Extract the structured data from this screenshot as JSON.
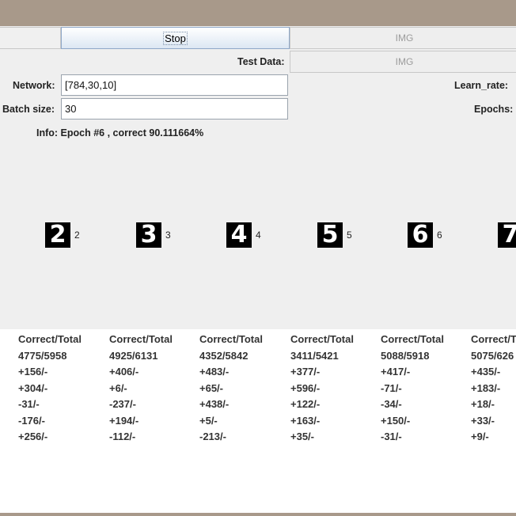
{
  "toolbar": {
    "stop_label": "Stop",
    "img_label_1": "IMG",
    "img_label_2": "IMG",
    "test_data_label": "Test Data:"
  },
  "config": {
    "network_label": "Network:",
    "network_value": "[784,30,10]",
    "batch_label": "Batch size:",
    "batch_value": "30",
    "learn_rate_label": "Learn_rate:",
    "epochs_label": "Epochs:"
  },
  "info": "Info: Epoch #6 , correct 90.111664%",
  "digits": [
    {
      "glyph": "2",
      "label": "2"
    },
    {
      "glyph": "3",
      "label": "3"
    },
    {
      "glyph": "4",
      "label": "4"
    },
    {
      "glyph": "5",
      "label": "5"
    },
    {
      "glyph": "6",
      "label": "6"
    },
    {
      "glyph": "7",
      "label": ""
    }
  ],
  "stats": [
    {
      "header": "Correct/Total",
      "total": "4775/5958",
      "deltas": [
        "+156/-",
        "+304/-",
        "-31/-",
        "-176/-",
        "+256/-"
      ]
    },
    {
      "header": "Correct/Total",
      "total": "4925/6131",
      "deltas": [
        "+406/-",
        "+6/-",
        "-237/-",
        "+194/-",
        "-112/-"
      ]
    },
    {
      "header": "Correct/Total",
      "total": "4352/5842",
      "deltas": [
        "+483/-",
        "+65/-",
        "+438/-",
        "+5/-",
        "-213/-"
      ]
    },
    {
      "header": "Correct/Total",
      "total": "3411/5421",
      "deltas": [
        "+377/-",
        "+596/-",
        "+122/-",
        "+163/-",
        "+35/-"
      ]
    },
    {
      "header": "Correct/Total",
      "total": "5088/5918",
      "deltas": [
        "+417/-",
        "-71/-",
        "-34/-",
        "+150/-",
        "-31/-"
      ]
    },
    {
      "header": "Correct/T",
      "total": "5075/626",
      "deltas": [
        "+435/-",
        "+183/-",
        "+18/-",
        "+33/-",
        "+9/-"
      ]
    }
  ]
}
